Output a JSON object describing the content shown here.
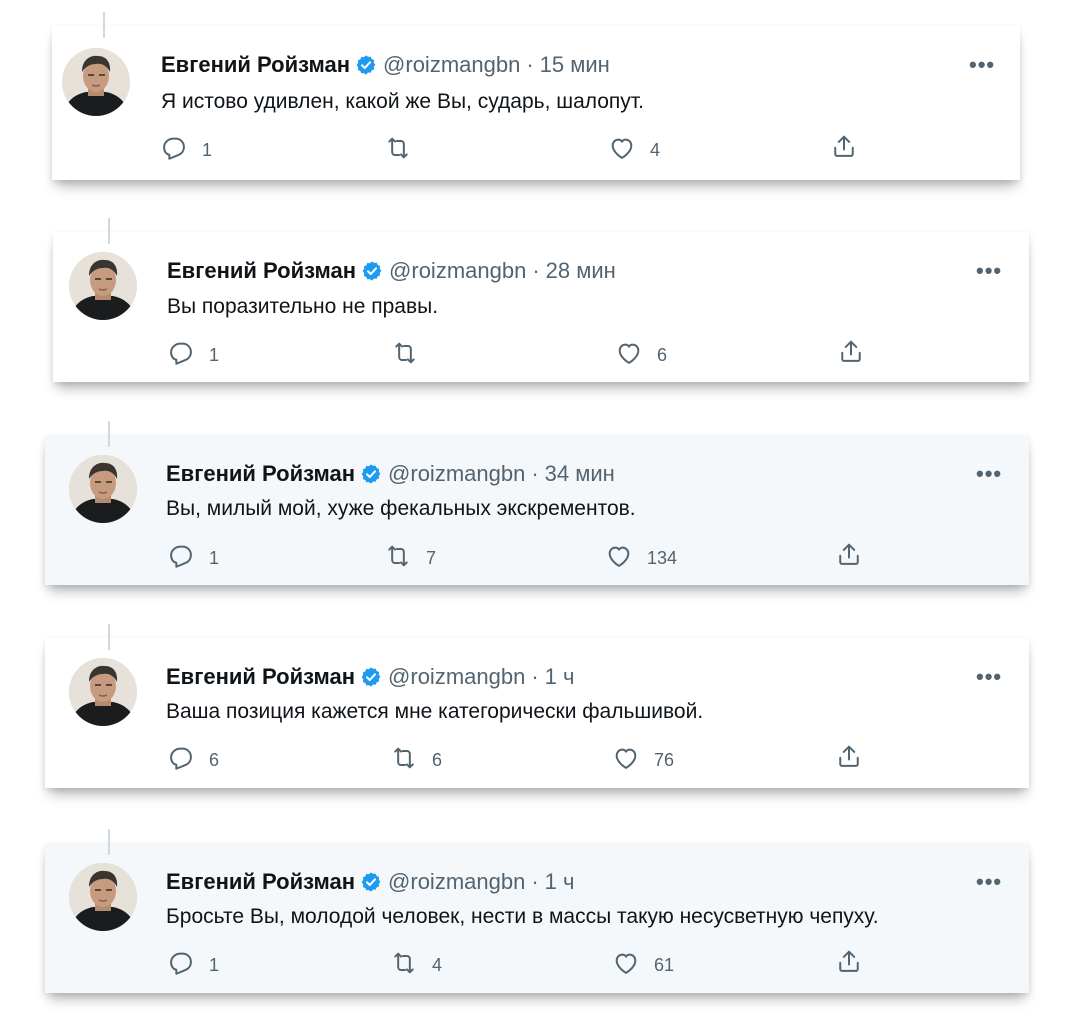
{
  "author": {
    "name": "Евгений Ройзман",
    "handle": "@roizmangbn"
  },
  "separator": "·",
  "more_label": "•••",
  "icons": {
    "reply": "reply-icon",
    "retweet": "retweet-icon",
    "like": "heart-icon",
    "share": "share-icon",
    "verified": "verified-badge-icon"
  },
  "colors": {
    "verified": "#1d9bf0",
    "icon_gray": "#536471",
    "thread_line": "#cfd9de"
  },
  "tweets": [
    {
      "time": "15 мин",
      "text": "Я истово удивлен, какой же Вы, сударь, шалопут.",
      "replies": "1",
      "retweets": "",
      "likes": "4"
    },
    {
      "time": "28 мин",
      "text": "Вы поразительно не правы.",
      "replies": "1",
      "retweets": "",
      "likes": "6"
    },
    {
      "time": "34 мин",
      "text": "Вы, милый мой, хуже фекальных экскрементов.",
      "replies": "1",
      "retweets": "7",
      "likes": "134"
    },
    {
      "time": "1 ч",
      "text": "Ваша позиция кажется мне категорически фальшивой.",
      "replies": "6",
      "retweets": "6",
      "likes": "76"
    },
    {
      "time": "1 ч",
      "text": "Бросьте Вы, молодой человек, нести в массы такую несусветную чепуху.",
      "replies": "1",
      "retweets": "4",
      "likes": "61"
    }
  ]
}
